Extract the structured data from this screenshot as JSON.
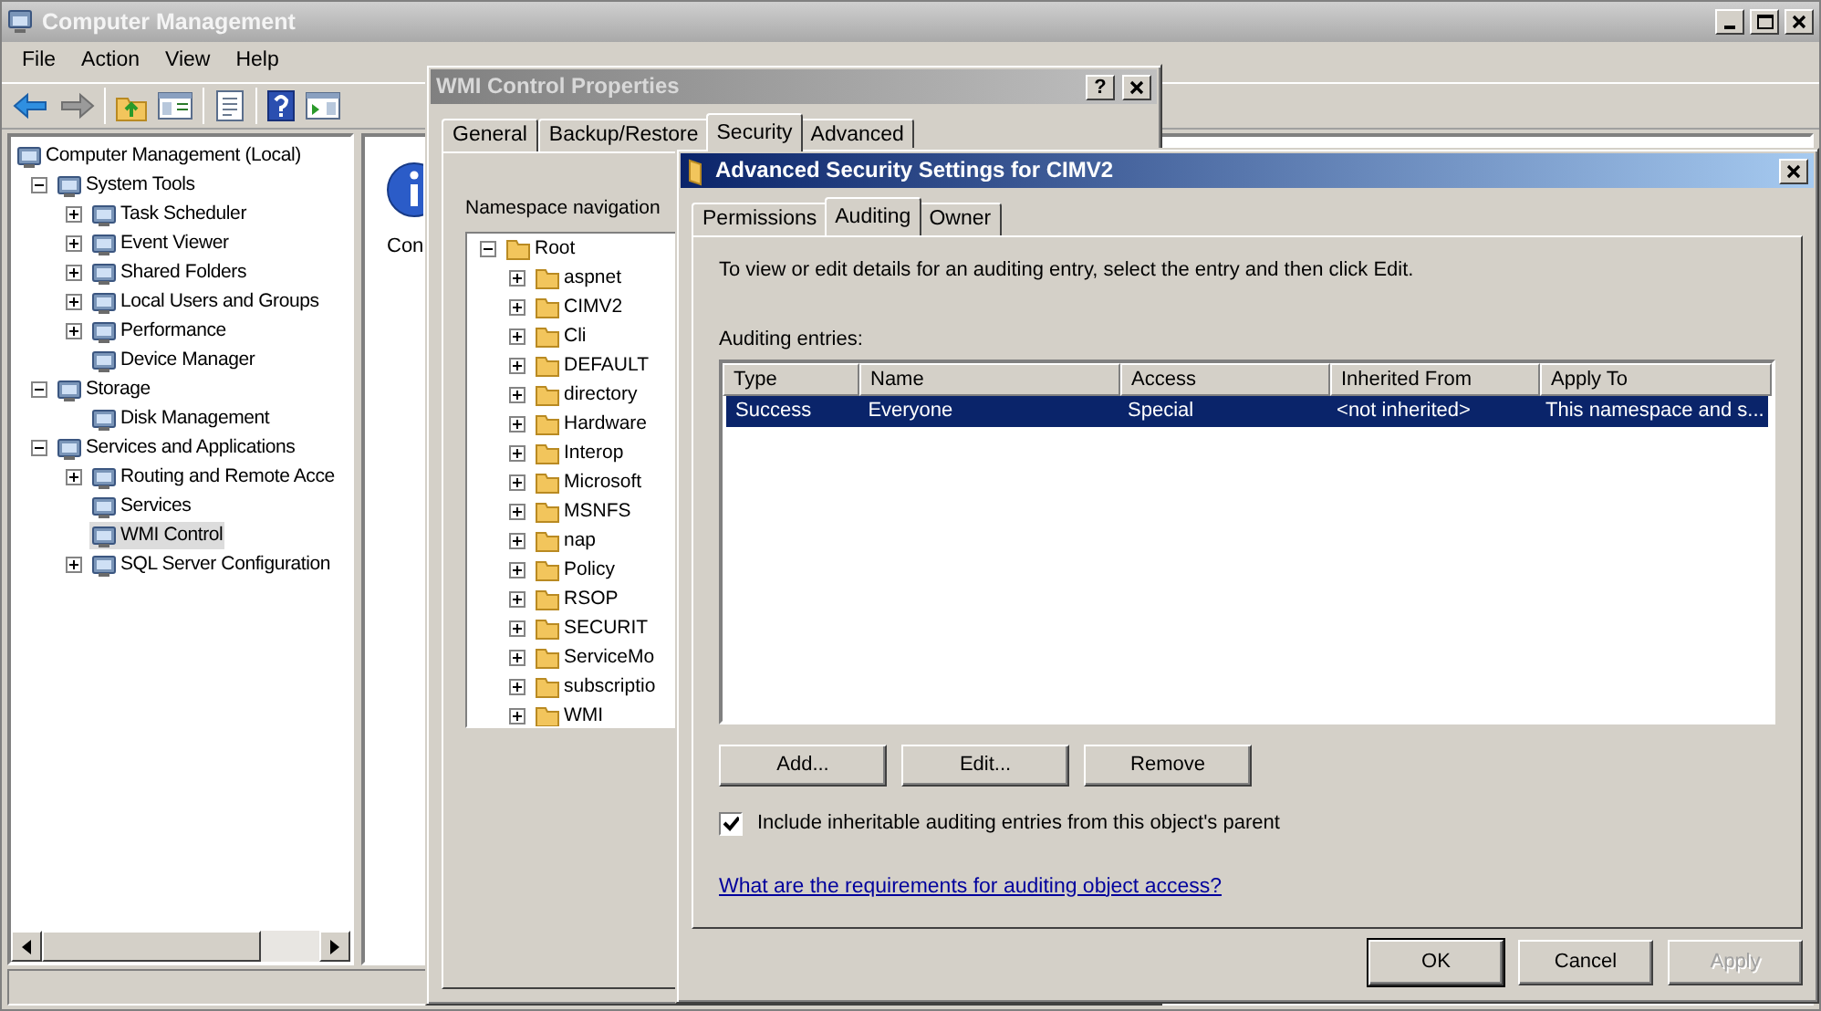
{
  "main_window": {
    "title": "Computer Management",
    "menu": [
      "File",
      "Action",
      "View",
      "Help"
    ],
    "tree": [
      {
        "label": "Computer Management (Local)",
        "selected": false,
        "children": [
          {
            "label": "System Tools",
            "expanded": true,
            "selected": false,
            "children": [
              {
                "label": "Task Scheduler",
                "expanded": false,
                "selected": false
              },
              {
                "label": "Event Viewer",
                "expanded": false,
                "selected": false
              },
              {
                "label": "Shared Folders",
                "expanded": false,
                "selected": false
              },
              {
                "label": "Local Users and Groups",
                "expanded": false,
                "selected": false
              },
              {
                "label": "Performance",
                "expanded": false,
                "selected": false
              },
              {
                "label": "Device Manager",
                "selected": false
              }
            ]
          },
          {
            "label": "Storage",
            "expanded": true,
            "selected": false,
            "children": [
              {
                "label": "Disk Management",
                "selected": false
              }
            ]
          },
          {
            "label": "Services and Applications",
            "expanded": true,
            "selected": false,
            "children": [
              {
                "label": "Routing and Remote Acce",
                "expanded": false,
                "selected": false
              },
              {
                "label": "Services",
                "selected": false
              },
              {
                "label": "WMI Control",
                "selected": true
              },
              {
                "label": "SQL Server Configuration",
                "expanded": false,
                "selected": false
              }
            ]
          }
        ]
      }
    ],
    "details": {
      "text": "Con"
    }
  },
  "wmi_dialog": {
    "title": "WMI Control Properties",
    "help": "?",
    "tabs": [
      {
        "label": "General",
        "selected": false
      },
      {
        "label": "Backup/Restore",
        "selected": false
      },
      {
        "label": "Security",
        "selected": true
      },
      {
        "label": "Advanced",
        "selected": false
      }
    ],
    "namespace_label": "Namespace navigation",
    "tree": [
      {
        "label": "Root",
        "expanded": true,
        "selected": false,
        "children": [
          {
            "label": "aspnet",
            "expanded": false,
            "selected": false
          },
          {
            "label": "CIMV2",
            "expanded": false,
            "selected": false
          },
          {
            "label": "Cli",
            "expanded": false,
            "selected": false
          },
          {
            "label": "DEFAULT",
            "expanded": false,
            "selected": false
          },
          {
            "label": "directory",
            "expanded": false,
            "selected": false
          },
          {
            "label": "Hardware",
            "expanded": false,
            "selected": false
          },
          {
            "label": "Interop",
            "expanded": false,
            "selected": false
          },
          {
            "label": "Microsoft",
            "expanded": false,
            "selected": false
          },
          {
            "label": "MSNFS",
            "expanded": false,
            "selected": false
          },
          {
            "label": "nap",
            "expanded": false,
            "selected": false
          },
          {
            "label": "Policy",
            "expanded": false,
            "selected": false
          },
          {
            "label": "RSOP",
            "expanded": false,
            "selected": false
          },
          {
            "label": "SECURIT",
            "expanded": false,
            "selected": false
          },
          {
            "label": "ServiceMo",
            "expanded": false,
            "selected": false
          },
          {
            "label": "subscriptio",
            "expanded": false,
            "selected": false
          },
          {
            "label": "WMI",
            "expanded": false,
            "selected": false
          }
        ]
      }
    ]
  },
  "advanced_dialog": {
    "title": "Advanced Security Settings for CIMV2",
    "tabs": [
      {
        "label": "Permissions",
        "selected": false
      },
      {
        "label": "Auditing",
        "selected": true
      },
      {
        "label": "Owner",
        "selected": false
      }
    ],
    "instructions": "To view or edit details for an auditing entry, select the entry and then click Edit.",
    "entries_label": "Auditing entries:",
    "columns": [
      "Type",
      "Name",
      "Access",
      "Inherited From",
      "Apply To"
    ],
    "rows": [
      {
        "cells": [
          "Success",
          "Everyone",
          "Special",
          "<not inherited>",
          "This namespace and s..."
        ],
        "selected": true
      }
    ],
    "buttons": [
      "Add...",
      "Edit...",
      "Remove"
    ],
    "inherit_checkbox": {
      "label": "Include inheritable auditing entries from this object's parent",
      "checked": true
    },
    "help_link": "What are the requirements for auditing object access?",
    "footer_buttons": [
      {
        "label": "OK",
        "default": true,
        "disabled": false
      },
      {
        "label": "Cancel",
        "default": false,
        "disabled": false
      },
      {
        "label": "Apply",
        "default": false,
        "disabled": true
      }
    ]
  }
}
